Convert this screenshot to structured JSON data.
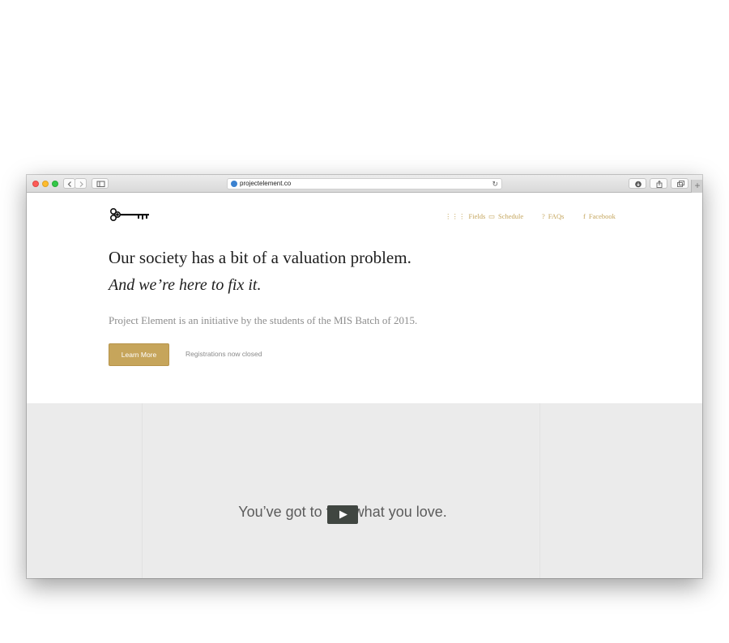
{
  "browser": {
    "url": "projectelement.co",
    "reload_glyph": "↻",
    "new_tab_glyph": "+"
  },
  "nav": {
    "items": [
      {
        "label": "Fields",
        "icon": "grid-icon",
        "glyph": "⋮⋮⋮"
      },
      {
        "label": "Schedule",
        "icon": "calendar-icon",
        "glyph": "▭"
      },
      {
        "label": "FAQs",
        "icon": "question-icon",
        "glyph": "?"
      },
      {
        "label": "Facebook",
        "icon": "facebook-icon",
        "glyph": "f"
      }
    ]
  },
  "hero": {
    "headline": "Our society has a bit of a valuation problem.",
    "subheadline": "And we’re here to fix it.",
    "description": "Project Element is an initiative by the students of the MIS Batch of 2015.",
    "learn_more_label": "Learn More",
    "registration_status": "Registrations now closed"
  },
  "video": {
    "caption": "You’ve got to find what you love."
  },
  "colors": {
    "accent": "#c6a55b",
    "video_bg": "#ebebeb",
    "play_button": "#404641"
  }
}
